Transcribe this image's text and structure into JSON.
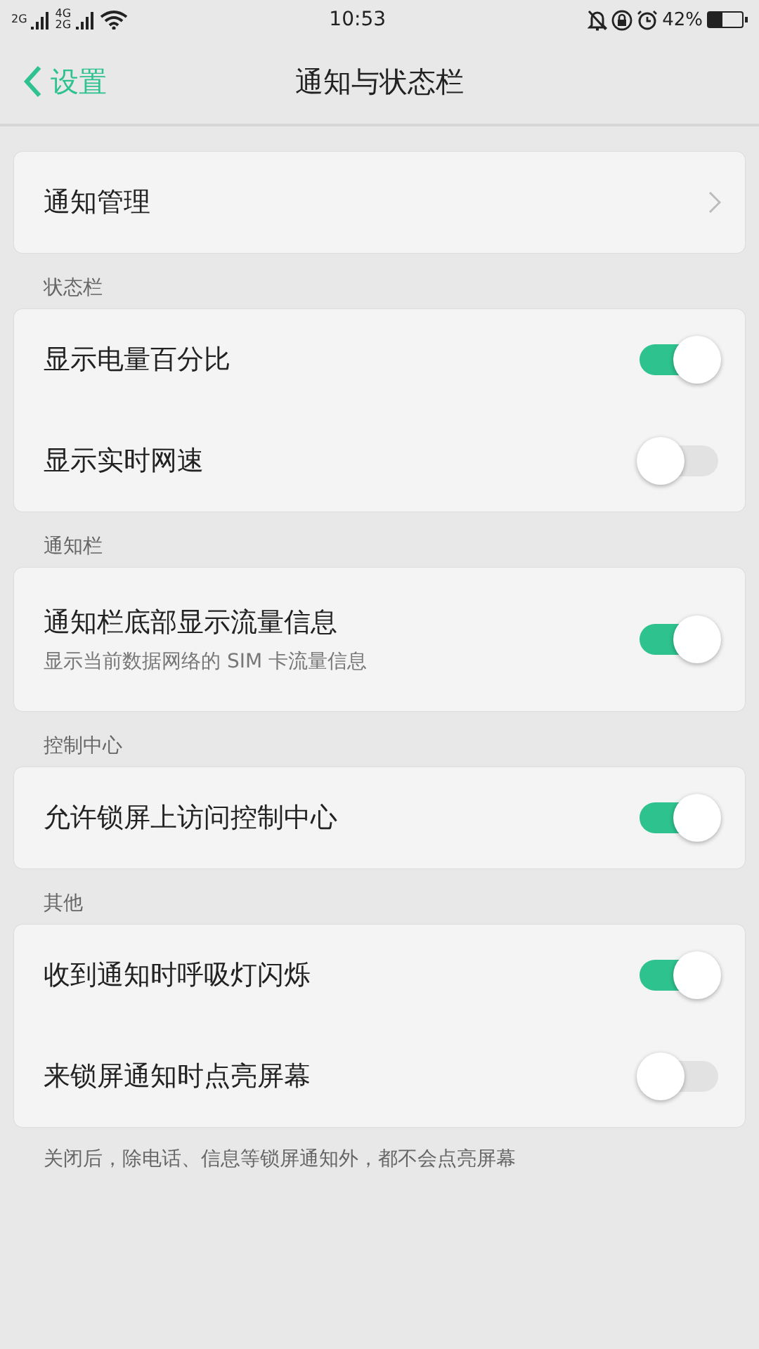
{
  "status_bar": {
    "sim1": "2G",
    "sim2_top": "4G",
    "sim2_bottom": "2G",
    "time": "10:53",
    "battery": "42%"
  },
  "header": {
    "back": "设置",
    "title": "通知与状态栏"
  },
  "sections": [
    {
      "rows": [
        {
          "kind": "link",
          "label": "通知管理"
        }
      ]
    },
    {
      "title": "状态栏",
      "rows": [
        {
          "kind": "switch",
          "label": "显示电量百分比",
          "on": true
        },
        {
          "kind": "switch",
          "label": "显示实时网速",
          "on": false
        }
      ]
    },
    {
      "title": "通知栏",
      "rows": [
        {
          "kind": "switch",
          "label": "通知栏底部显示流量信息",
          "subtitle": "显示当前数据网络的 SIM 卡流量信息",
          "on": true
        }
      ]
    },
    {
      "title": "控制中心",
      "rows": [
        {
          "kind": "switch",
          "label": "允许锁屏上访问控制中心",
          "on": true
        }
      ]
    },
    {
      "title": "其他",
      "rows": [
        {
          "kind": "switch",
          "label": "收到通知时呼吸灯闪烁",
          "on": true
        },
        {
          "kind": "switch",
          "label": "来锁屏通知时点亮屏幕",
          "on": false
        }
      ]
    }
  ],
  "footer": "关闭后，除电话、信息等锁屏通知外，都不会点亮屏幕"
}
